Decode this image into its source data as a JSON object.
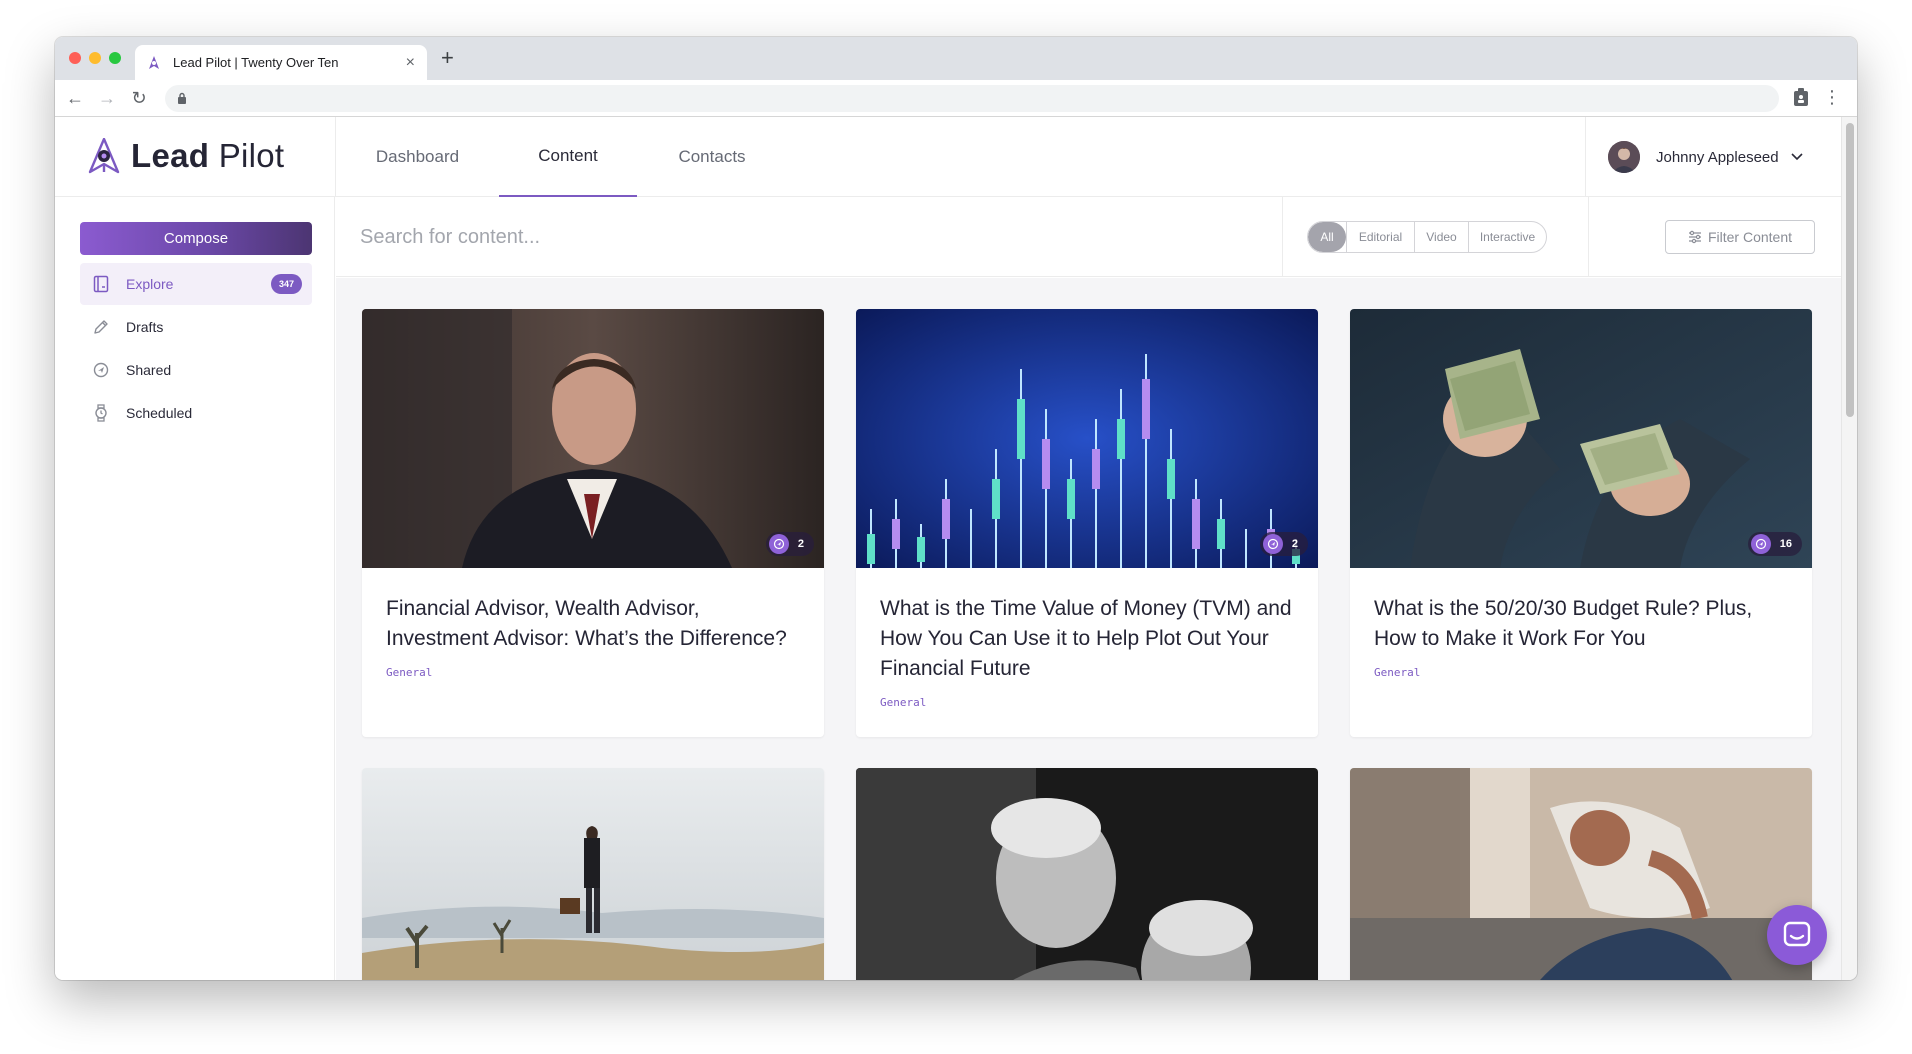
{
  "browser": {
    "tab_title": "Lead Pilot | Twenty Over Ten",
    "tab_close_glyph": "×",
    "new_tab_glyph": "+",
    "back_glyph": "←",
    "forward_glyph": "→",
    "reload_glyph": "↻",
    "menu_glyph": "⋮"
  },
  "brand": {
    "name_bold": "Lead",
    "name_rest": " Pilot",
    "accent": "#7c5ac2"
  },
  "nav": {
    "tabs": [
      {
        "label": "Dashboard"
      },
      {
        "label": "Content"
      },
      {
        "label": "Contacts"
      }
    ]
  },
  "user": {
    "name": "Johnny Appleseed"
  },
  "sidebar": {
    "compose_label": "Compose",
    "items": [
      {
        "label": "Explore",
        "badge": "347",
        "icon": "explore-icon"
      },
      {
        "label": "Drafts",
        "icon": "pencil-icon"
      },
      {
        "label": "Shared",
        "icon": "shared-icon"
      },
      {
        "label": "Scheduled",
        "icon": "clock-icon"
      }
    ]
  },
  "search": {
    "placeholder": "Search for content..."
  },
  "filters": {
    "segments": [
      "All",
      "Editorial",
      "Video",
      "Interactive"
    ],
    "selected": "All",
    "filter_label": "Filter Content"
  },
  "cards": [
    {
      "title": "Financial Advisor, Wealth Advisor, Investment Advisor: What’s the Difference?",
      "tag": "General",
      "shares": "2"
    },
    {
      "title": "What is the Time Value of Money (TVM) and How You Can Use it to Help Plot Out Your Financial Future",
      "tag": "General",
      "shares": "2"
    },
    {
      "title": "What is the 50/20/30 Budget Rule? Plus, How to Make it Work For You",
      "tag": "General",
      "shares": "16"
    }
  ]
}
